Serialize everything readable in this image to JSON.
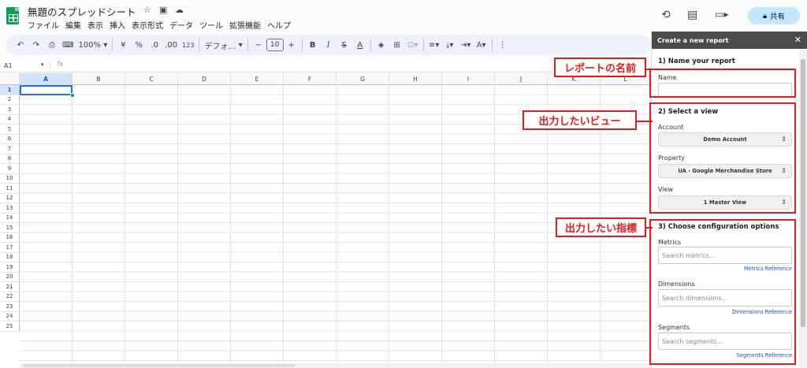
{
  "header": {
    "doc_title": "無題のスプレッドシート",
    "share_label": "共有",
    "menu": [
      "ファイル",
      "編集",
      "表示",
      "挿入",
      "表示形式",
      "データ",
      "ツール",
      "拡張機能",
      "ヘルプ"
    ]
  },
  "toolbar": {
    "zoom": "100%",
    "currency": "¥",
    "percent": "%",
    "dec_decrease": ".0",
    "dec_increase": ".00",
    "number_format": "123",
    "font": "デフォ…",
    "font_size": "10"
  },
  "formula_bar": {
    "cell_ref": "A1",
    "fx": "fx"
  },
  "grid": {
    "columns": [
      "A",
      "B",
      "C",
      "D",
      "E",
      "F",
      "G",
      "H",
      "I",
      "J",
      "K",
      "L"
    ],
    "rows": [
      "1",
      "2",
      "3",
      "4",
      "5",
      "6",
      "7",
      "8",
      "9",
      "10",
      "11",
      "12",
      "13",
      "14",
      "15",
      "16",
      "17",
      "18",
      "19",
      "20",
      "21",
      "22",
      "23",
      "24",
      "25"
    ],
    "selected_cell": "A1"
  },
  "panel": {
    "title": "Create a new report",
    "section1": {
      "title": "1) Name your report",
      "name_label": "Name",
      "name_value": ""
    },
    "section2": {
      "title": "2) Select a view",
      "account_label": "Account",
      "account_value": "Demo Account",
      "property_label": "Property",
      "property_value": "UA - Google Merchandise Store",
      "view_label": "View",
      "view_value": "1 Master View"
    },
    "section3": {
      "title": "3) Choose configuration options",
      "metrics_label": "Metrics",
      "metrics_placeholder": "Search metrics...",
      "metrics_ref": "Metrics Reference",
      "dimensions_label": "Dimensions",
      "dimensions_placeholder": "Search dimensions...",
      "dimensions_ref": "Dimensions Reference",
      "segments_label": "Segments",
      "segments_placeholder": "Search segments...",
      "segments_ref": "Segments Reference"
    }
  },
  "annotations": {
    "report_name": "レポートの名前",
    "view": "出力したいビュー",
    "metrics": "出力したい指標"
  },
  "colors": {
    "annotation_red": "#e11d1d",
    "share_bg": "#c2e7ff",
    "selection_blue": "#1a73e8",
    "panel_header": "#4b4b4b"
  }
}
